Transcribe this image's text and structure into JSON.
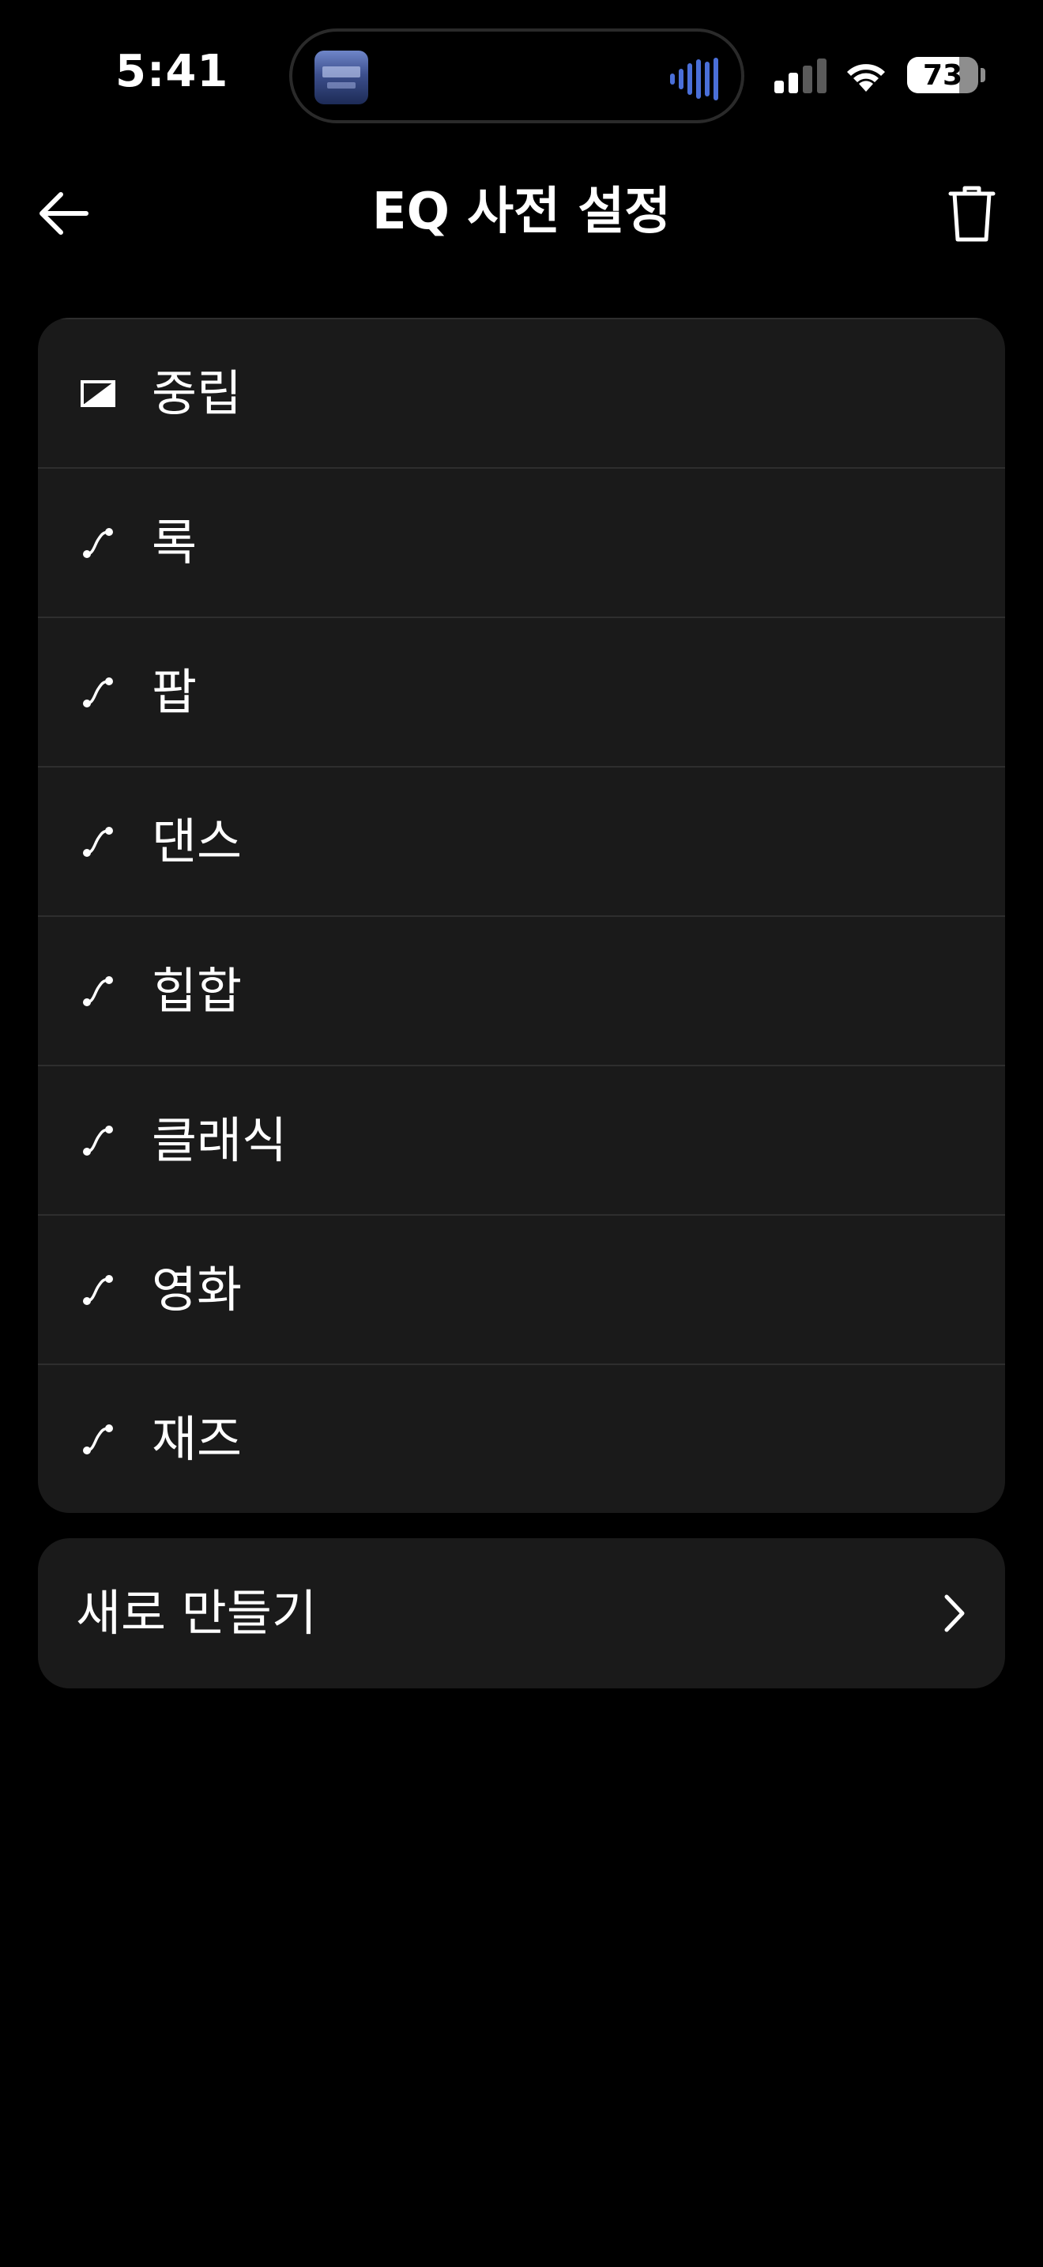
{
  "status_bar": {
    "time": "5:41",
    "battery_percent": "73",
    "battery_level": 0.73
  },
  "header": {
    "title": "EQ 사전 설정",
    "back_icon": "arrow-left-icon",
    "delete_icon": "trash-icon"
  },
  "presets": [
    {
      "label": "중립",
      "icon": "neutral-eq-icon"
    },
    {
      "label": "록",
      "icon": "eq-curve-icon"
    },
    {
      "label": "팝",
      "icon": "eq-curve-icon"
    },
    {
      "label": "댄스",
      "icon": "eq-curve-icon"
    },
    {
      "label": "힙합",
      "icon": "eq-curve-icon"
    },
    {
      "label": "클래식",
      "icon": "eq-curve-icon"
    },
    {
      "label": "영화",
      "icon": "eq-curve-icon"
    },
    {
      "label": "재즈",
      "icon": "eq-curve-icon"
    }
  ],
  "create_new": {
    "label": "새로 만들기",
    "icon": "chevron-right-icon"
  },
  "colors": {
    "background": "#000000",
    "card": "#1a1a1a",
    "divider": "#2e2e2e",
    "text": "#ffffff",
    "waveform": "#4a6fd8"
  }
}
